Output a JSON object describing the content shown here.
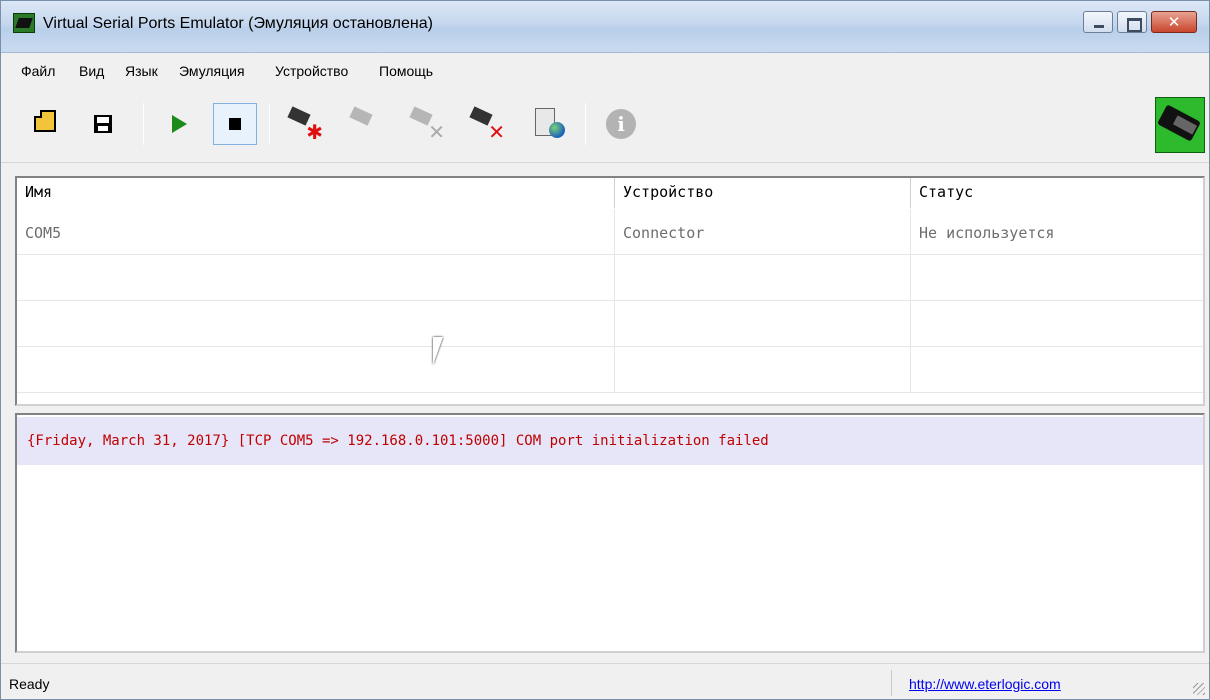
{
  "window": {
    "title": "Virtual Serial Ports Emulator (Эмуляция остановлена)",
    "close_glyph": "✕"
  },
  "menu": {
    "items": [
      "Файл",
      "Вид",
      "Язык",
      "Эмуляция",
      "Устройство",
      "Помощь"
    ]
  },
  "toolbar": {
    "buttons": [
      {
        "icon": "open-folder-icon"
      },
      {
        "icon": "save-disk-icon"
      },
      {
        "icon": "play-icon",
        "color": "#1a8a1a"
      },
      {
        "icon": "stop-icon",
        "pressed": true
      },
      {
        "icon": "new-device-icon"
      },
      {
        "icon": "device-properties-icon",
        "disabled": true
      },
      {
        "icon": "disconnect-device-icon",
        "disabled": true
      },
      {
        "icon": "delete-device-icon"
      },
      {
        "icon": "network-monitor-icon"
      },
      {
        "icon": "info-icon",
        "disabled": true
      }
    ],
    "info_glyph": "i",
    "star_glyph": "✱",
    "x_glyph": "✕"
  },
  "ports": {
    "columns": [
      "Имя",
      "Устройство",
      "Статус"
    ],
    "rows": [
      {
        "name": "COM5",
        "device": "Connector",
        "status": "Не используется"
      }
    ]
  },
  "log": {
    "lines": [
      "{Friday, March 31, 2017} [TCP COM5 => 192.168.0.101:5000] COM port initialization failed"
    ],
    "color": "#c00000"
  },
  "status": {
    "text": "Ready",
    "link": "http://www.eterlogic.com"
  }
}
